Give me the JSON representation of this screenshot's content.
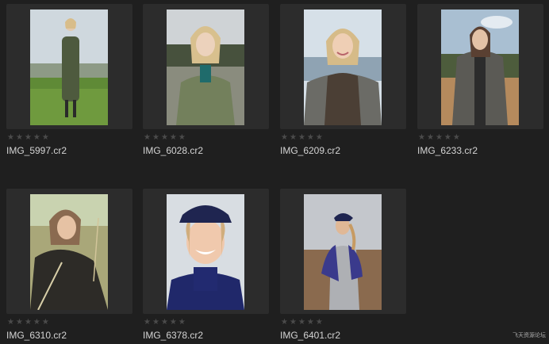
{
  "files": [
    {
      "name": "IMG_5997.cr2",
      "rating": 0
    },
    {
      "name": "IMG_6028.cr2",
      "rating": 0
    },
    {
      "name": "IMG_6209.cr2",
      "rating": 0
    },
    {
      "name": "IMG_6233.cr2",
      "rating": 0
    },
    {
      "name": "IMG_6310.cr2",
      "rating": 0
    },
    {
      "name": "IMG_6378.cr2",
      "rating": 0
    },
    {
      "name": "IMG_6401.cr2",
      "rating": 0
    }
  ],
  "star_glyph": "★",
  "watermark": "飞天资源论坛"
}
